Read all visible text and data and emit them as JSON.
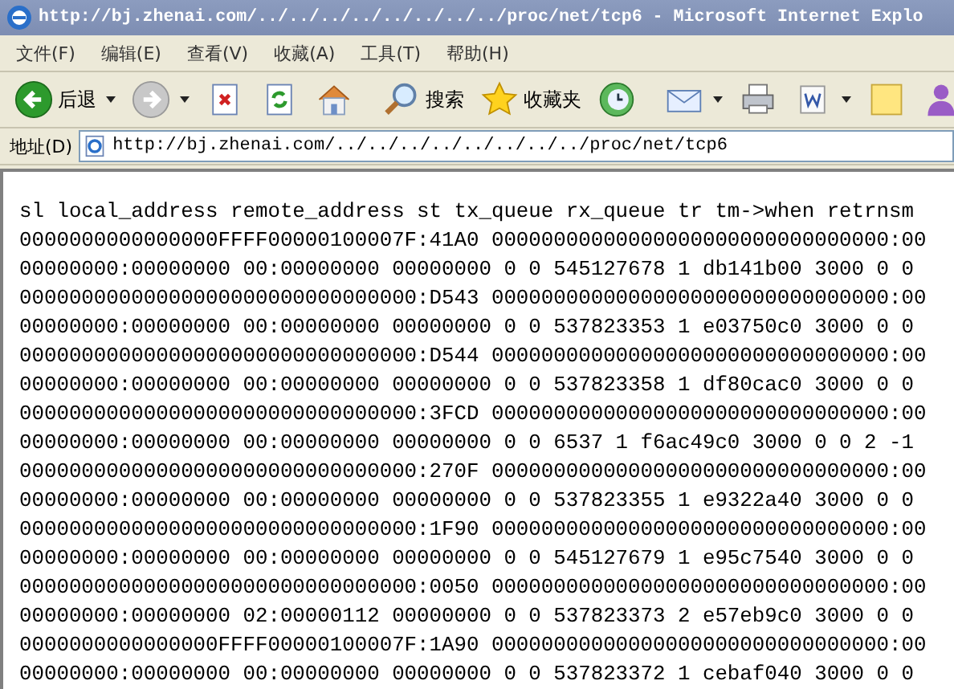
{
  "window": {
    "title": "http://bj.zhenai.com/../../../../../../../../proc/net/tcp6 - Microsoft Internet Explo"
  },
  "menu": [
    {
      "label": "文件(F)"
    },
    {
      "label": "编辑(E)"
    },
    {
      "label": "查看(V)"
    },
    {
      "label": "收藏(A)"
    },
    {
      "label": "工具(T)"
    },
    {
      "label": "帮助(H)"
    }
  ],
  "toolbar": [
    {
      "kind": "back",
      "label": "后退",
      "dropdown": true
    },
    {
      "kind": "forward",
      "dropdown": true
    },
    {
      "kind": "stop",
      "dropdown": false
    },
    {
      "kind": "refresh",
      "dropdown": false
    },
    {
      "kind": "home",
      "dropdown": false
    },
    {
      "kind": "separator"
    },
    {
      "kind": "search",
      "label": "搜索",
      "dropdown": false
    },
    {
      "kind": "favorites",
      "label": "收藏夹",
      "dropdown": false
    },
    {
      "kind": "history",
      "dropdown": false
    },
    {
      "kind": "separator"
    },
    {
      "kind": "mail",
      "dropdown": true
    },
    {
      "kind": "print",
      "dropdown": false
    },
    {
      "kind": "edit",
      "dropdown": true
    },
    {
      "kind": "note",
      "dropdown": false
    },
    {
      "kind": "messenger",
      "dropdown": false
    }
  ],
  "address_bar": {
    "label": "地址(D)",
    "value": "http://bj.zhenai.com/../../../../../../../../proc/net/tcp6"
  },
  "content": {
    "lines": [
      "sl local_address remote_address st tx_queue rx_queue tr tm->when retrnsm",
      "0000000000000000FFFF00000100007F:41A0 00000000000000000000000000000000:00",
      "00000000:00000000 00:00000000 00000000 0 0 545127678 1 db141b00 3000 0 0",
      "00000000000000000000000000000000:D543 00000000000000000000000000000000:00",
      "00000000:00000000 00:00000000 00000000 0 0 537823353 1 e03750c0 3000 0 0",
      "00000000000000000000000000000000:D544 00000000000000000000000000000000:00",
      "00000000:00000000 00:00000000 00000000 0 0 537823358 1 df80cac0 3000 0 0",
      "00000000000000000000000000000000:3FCD 00000000000000000000000000000000:00",
      "00000000:00000000 00:00000000 00000000 0 0 6537 1 f6ac49c0 3000 0 0 2 -1",
      "00000000000000000000000000000000:270F 00000000000000000000000000000000:00",
      "00000000:00000000 00:00000000 00000000 0 0 537823355 1 e9322a40 3000 0 0",
      "00000000000000000000000000000000:1F90 00000000000000000000000000000000:00",
      "00000000:00000000 00:00000000 00000000 0 0 545127679 1 e95c7540 3000 0 0",
      "00000000000000000000000000000000:0050 00000000000000000000000000000000:00",
      "00000000:00000000 02:00000112 00000000 0 0 537823373 2 e57eb9c0 3000 0 0",
      "0000000000000000FFFF00000100007F:1A90 00000000000000000000000000000000:00",
      "00000000:00000000 00:00000000 00000000 0 0 537823372 1 cebaf040 3000 0 0"
    ]
  }
}
